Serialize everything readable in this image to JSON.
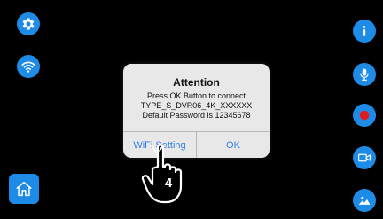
{
  "dialog": {
    "title": "Attention",
    "lines": [
      "Press OK Button to connect",
      "TYPE_S_DVR06_4K_XXXXXX",
      "Default Password is 12345678"
    ],
    "wifi_setting_label": "WiFi Setting",
    "ok_label": "OK"
  },
  "annotation": {
    "step_number": "4"
  },
  "icons": {
    "settings": "gear-icon",
    "wifi": "wifi-icon",
    "home": "home-icon",
    "info": "info-icon",
    "microphone": "microphone-icon",
    "record": "record-icon",
    "video": "video-camera-icon",
    "gallery": "gallery-icon"
  },
  "colors": {
    "accent_blue": "#1e8be6",
    "record_red": "#e01b1b",
    "dialog_bg": "#e8e8e8",
    "dialog_button_text": "#2f7fe8"
  }
}
